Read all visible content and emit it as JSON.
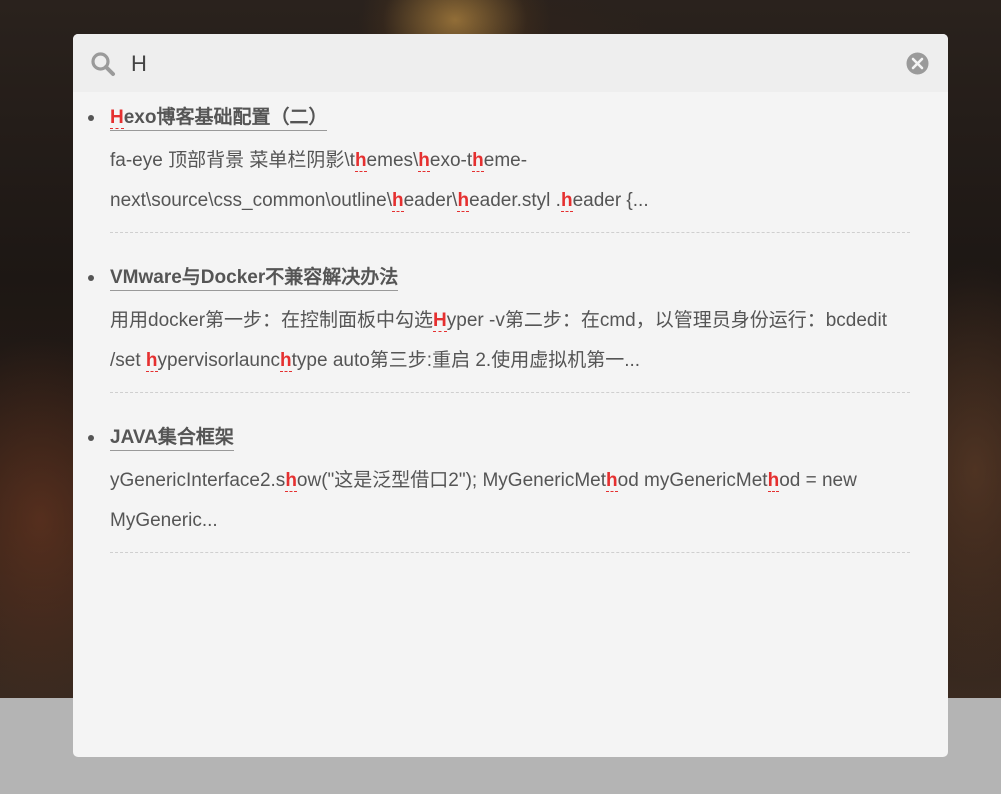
{
  "search": {
    "query": "H",
    "icon": "search-icon",
    "close_icon": "close-icon",
    "highlight_color": "#e53030"
  },
  "results": [
    {
      "title_parts": [
        {
          "t": "H",
          "hl": true
        },
        {
          "t": "exo博客基础配置（二）",
          "hl": false
        }
      ],
      "excerpt_parts": [
        {
          "t": "fa-eye 顶部背景 菜单栏阴影\\t",
          "hl": false
        },
        {
          "t": "h",
          "hl": true
        },
        {
          "t": "emes\\",
          "hl": false
        },
        {
          "t": "h",
          "hl": true
        },
        {
          "t": "exo-t",
          "hl": false
        },
        {
          "t": "h",
          "hl": true
        },
        {
          "t": "eme-next\\source\\css_common\\outline\\",
          "hl": false
        },
        {
          "t": "h",
          "hl": true
        },
        {
          "t": "eader\\",
          "hl": false
        },
        {
          "t": "h",
          "hl": true
        },
        {
          "t": "eader.styl .",
          "hl": false
        },
        {
          "t": "h",
          "hl": true
        },
        {
          "t": "eader {...",
          "hl": false
        }
      ]
    },
    {
      "title_parts": [
        {
          "t": "VMware与Docker不兼容解决办法",
          "hl": false
        }
      ],
      "excerpt_parts": [
        {
          "t": "用用docker第一步：在控制面板中勾选",
          "hl": false
        },
        {
          "t": "H",
          "hl": true
        },
        {
          "t": "yper -v第二步：在cmd，以管理员身份运行：bcdedit /set ",
          "hl": false
        },
        {
          "t": "h",
          "hl": true
        },
        {
          "t": "ypervisorlaunc",
          "hl": false
        },
        {
          "t": "h",
          "hl": true
        },
        {
          "t": "type auto第三步:重启 2.使用虚拟机第一...",
          "hl": false
        }
      ]
    },
    {
      "title_parts": [
        {
          "t": "JAVA集合框架",
          "hl": false
        }
      ],
      "excerpt_parts": [
        {
          "t": "yGenericInterface2.s",
          "hl": false
        },
        {
          "t": "h",
          "hl": true
        },
        {
          "t": "ow(\"这是泛型借口2\"); MyGenericMet",
          "hl": false
        },
        {
          "t": "h",
          "hl": true
        },
        {
          "t": "od myGenericMet",
          "hl": false
        },
        {
          "t": "h",
          "hl": true
        },
        {
          "t": "od = new MyGeneric...",
          "hl": false
        }
      ]
    }
  ]
}
